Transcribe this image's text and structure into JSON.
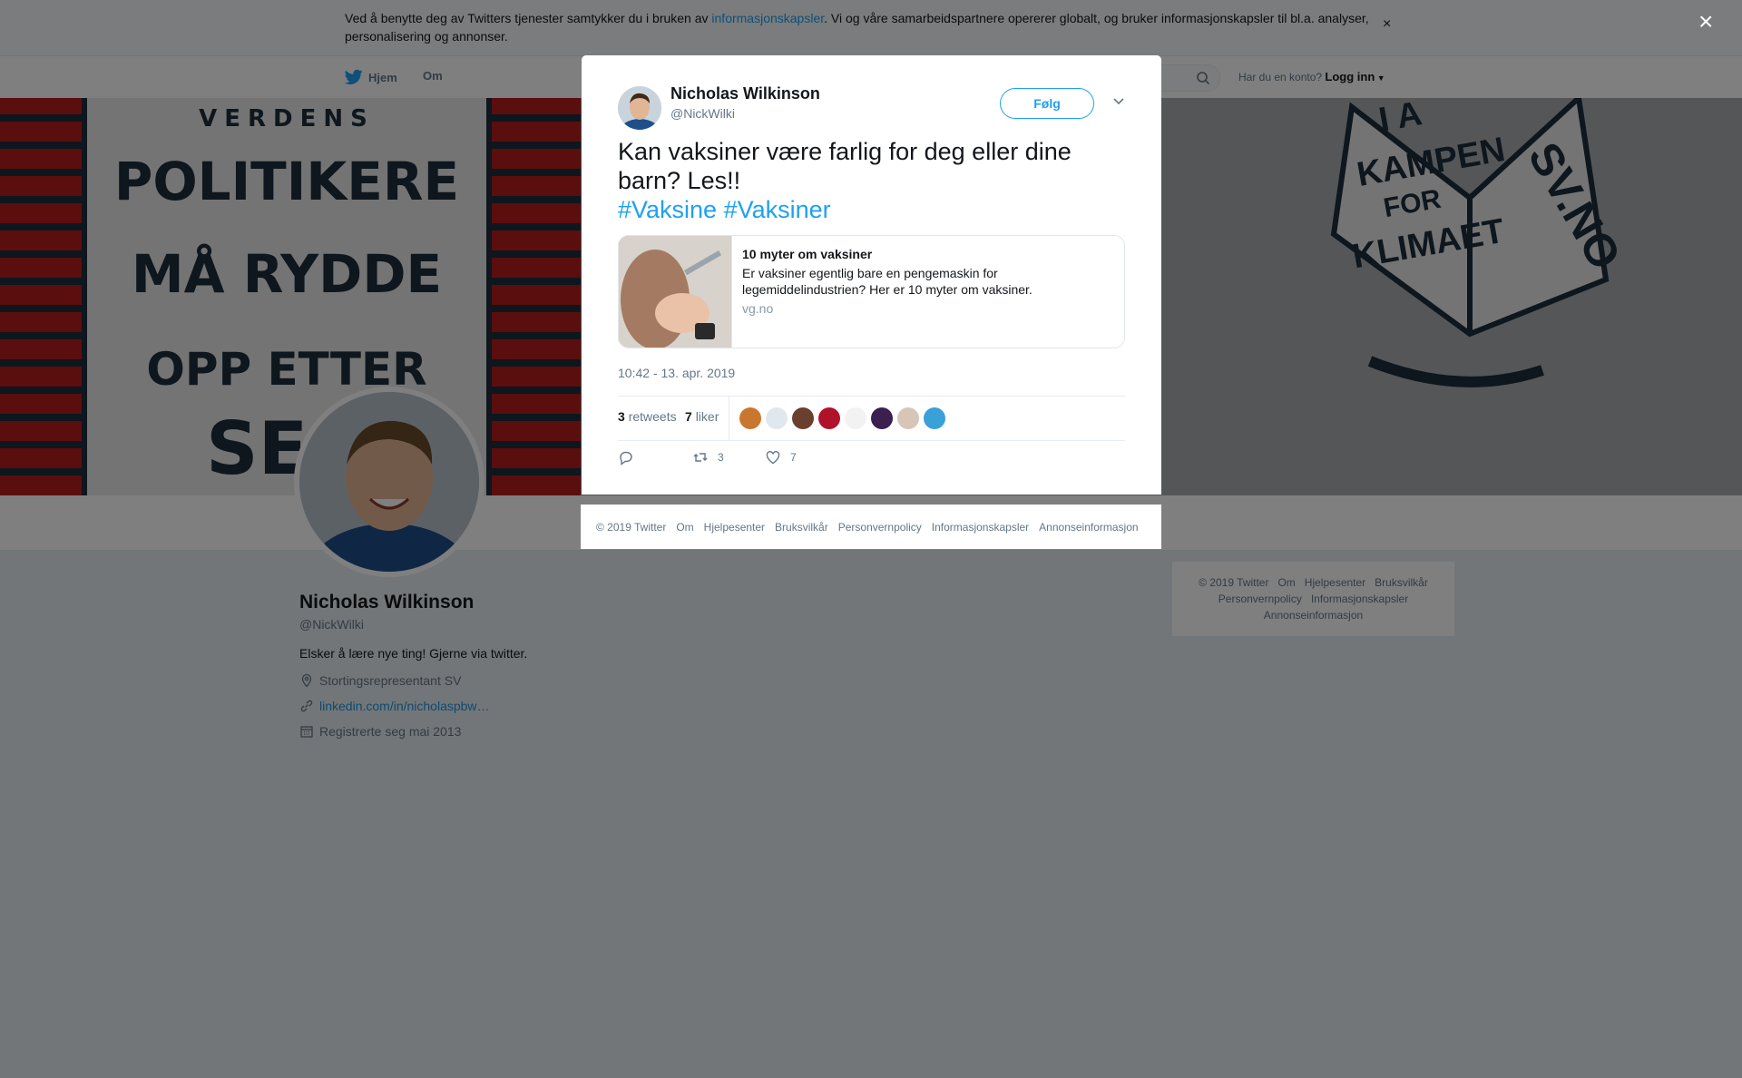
{
  "cookie_bar": {
    "text_before": "Ved å benytte deg av Twitters tjenester samtykker du i bruken av ",
    "link": "informasjonskapsler",
    "text_after": ". Vi og våre samarbeidspartnere opererer globalt, og bruker informasjonskapsler til bl.a. analyser, personalisering og annonser.",
    "close_label": "×"
  },
  "nav": {
    "home": "Hjem",
    "about": "Om",
    "login_prompt": "Har du en konto?",
    "login": "Logg inn"
  },
  "overlay_close": "×",
  "tweet": {
    "author_name": "Nicholas Wilkinson",
    "author_handle": "@NickWilki",
    "follow_label": "Følg",
    "text": "Kan vaksiner være farlig for deg eller dine barn? Les!!",
    "hashtags": [
      "#Vaksine",
      "#Vaksiner"
    ],
    "card": {
      "title": "10 myter om vaksiner",
      "description": "Er vaksiner egentlig bare en pengemaskin for legemiddelindustrien? Her er 10 myter om vaksiner.",
      "domain": "vg.no"
    },
    "timestamp": "10:42 - 13. apr. 2019",
    "retweets_count": "3",
    "retweets_label": "retweets",
    "likes_count": "7",
    "likes_label": "liker",
    "action_retweet_count": "3",
    "action_like_count": "7"
  },
  "modal_footer": [
    "© 2019 Twitter",
    "Om",
    "Hjelpesenter",
    "Bruksvilkår",
    "Personvernpolicy",
    "Informasjonskapsler",
    "Annonseinformasjon"
  ],
  "profile": {
    "name": "Nicholas Wilkinson",
    "handle": "@NickWilki",
    "bio": "Elsker å lære nye ting! Gjerne via twitter.",
    "location": "Stortingsrepresentant SV",
    "link": "linkedin.com/in/nicholaspbw…",
    "joined": "Registrerte seg mai 2013"
  },
  "side_footer": {
    "row1": [
      "© 2019 Twitter",
      "Om",
      "Hjelpesenter",
      "Bruksvilkår"
    ],
    "row2": [
      "Personvernpolicy",
      "Informasjonskapsler"
    ],
    "row3": [
      "Annonseinformasjon"
    ]
  },
  "banner": {
    "left_poster_lines": [
      "VERDENS",
      "POLITIKERE",
      "MÅ RYDDE",
      "OPP ETTER",
      "SEG"
    ],
    "right_book_lines": [
      "I A",
      "KAMPEN",
      "FOR",
      "KLIMAET",
      "SV.NO"
    ]
  },
  "colors": {
    "accent": "#1da1f2",
    "text_primary": "#14171a",
    "text_secondary": "#657786",
    "overlay": "rgba(0,0,0,0.5)"
  },
  "likers_colors": [
    "#c9772f",
    "#e1e8ed",
    "#6b3f2e",
    "#b0122a",
    "#f2f2f2",
    "#3b1f4f",
    "#d7c6b8",
    "#3aa0d8"
  ]
}
